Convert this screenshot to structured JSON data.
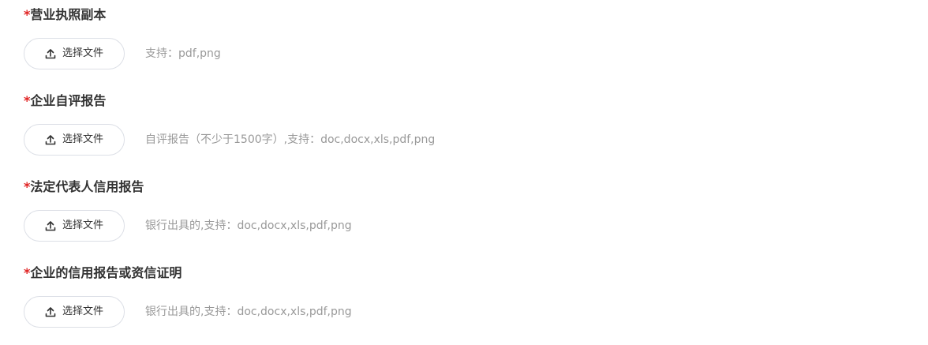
{
  "fields": [
    {
      "required_mark": "*",
      "label": "营业执照副本",
      "button_label": "选择文件",
      "button_icon": "upload-icon",
      "hint": "支持：pdf,png"
    },
    {
      "required_mark": "*",
      "label": "企业自评报告",
      "button_label": "选择文件",
      "button_icon": "upload-icon",
      "hint": "自评报告（不少于1500字）,支持：doc,docx,xls,pdf,png"
    },
    {
      "required_mark": "*",
      "label": "法定代表人信用报告",
      "button_label": "选择文件",
      "button_icon": "upload-icon",
      "hint": "银行出具的,支持：doc,docx,xls,pdf,png"
    },
    {
      "required_mark": "*",
      "label": "企业的信用报告或资信证明",
      "button_label": "选择文件",
      "button_icon": "upload-icon",
      "hint": "银行出具的,支持：doc,docx,xls,pdf,png"
    }
  ],
  "colors": {
    "required": "#e02020",
    "label": "#333333",
    "hint": "#999999",
    "button_border": "#dcdfe6"
  }
}
